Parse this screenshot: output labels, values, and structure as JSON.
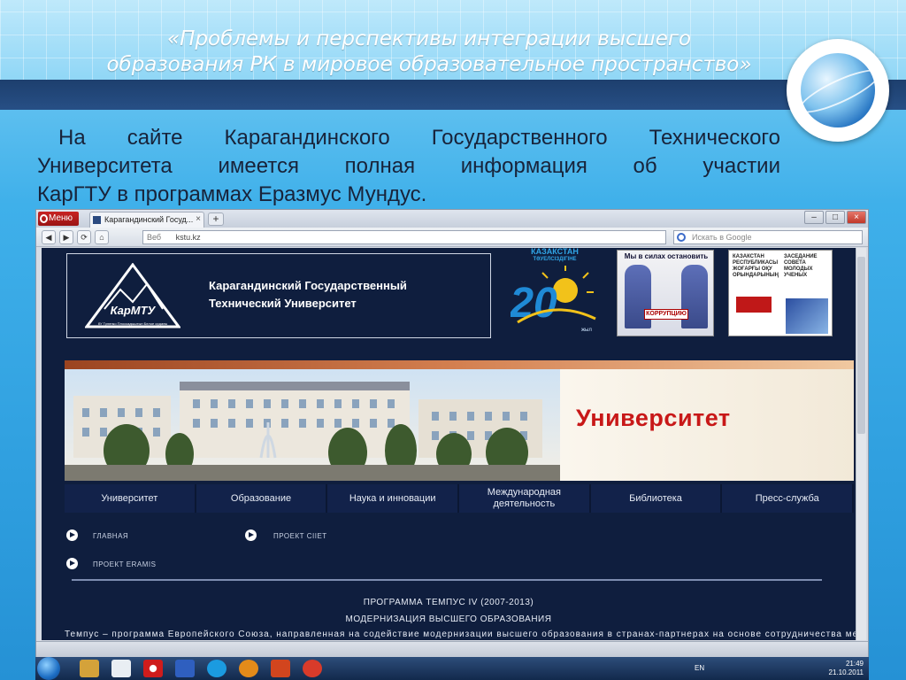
{
  "slide": {
    "title_lines": [
      "«Проблемы и перспективы интеграции высшего",
      "образования РК в мировое образовательное пространство»"
    ],
    "body_lines": [
      "На сайте Карагандинского Государственного Технического",
      "Университета имеется полная информация об участии",
      "КарГТУ в программах Еразмус Мундус."
    ]
  },
  "browser": {
    "menu_label": "Меню",
    "tab_title": "Карагандинский Госуд...",
    "new_tab": "+",
    "address_prefix": "Веб",
    "address_url": "kstu.kz",
    "search_placeholder": "Искать в Google",
    "nav_glyphs": {
      "back": "◀",
      "forward": "▶",
      "reload": "⟳",
      "home": "⌂"
    },
    "window_buttons": {
      "minimize": "–",
      "maximize": "□",
      "close": "×"
    }
  },
  "site": {
    "logo_text": "КарМТУ",
    "logo_subtext": "бУ Туленко Плоскадыштын Белое орданы",
    "university_name_lines": [
      "Карагандинский Государственный",
      "Технический Университет"
    ],
    "jubilee_lines": [
      "КАЗАКСТАН",
      "ТӘУЕЛСІЗДІГІНЕ"
    ],
    "jubilee_number": "20",
    "jubilee_suffix": "жыл",
    "poster1_title": "Мы в силах остановить",
    "poster1_badge": "КОРРУПЦИЮ",
    "poster2_col1": "КАЗАКСТАН РЕСПУБЛИКАСЫ ЖОҒАРҒЫ ОҚУ ОРЫНДАРЫНЫҢ",
    "poster2_col2": "ЗАСЕДАНИЕ СОВЕТА МОЛОДЫХ УЧЕНЫХ",
    "banner_word": "Университет",
    "menu": [
      "Университет",
      "Образование",
      "Наука и инновации",
      "Международная деятельность",
      "Библиотека",
      "Пресс-служба"
    ],
    "links": {
      "home": "ГЛАВНАЯ",
      "ciiet": "ПРОЕКТ CIIET",
      "eramis": "ПРОЕКТ ERAMIS"
    },
    "program_title": "ПРОГРАММА ТЕМПУС IV (2007-2013)",
    "program_subtitle": "МОДЕРНИЗАЦИЯ ВЫСШЕГО ОБРАЗОВАНИЯ",
    "tempus_text": "Темпус – программа Европейского Союза, направленная на содействие модернизации высшего образования в странах-партнерах на основе сотрудничества между"
  },
  "taskbar": {
    "lang": "EN",
    "time": "21:49",
    "date": "21.10.2011"
  },
  "colors": {
    "site_bg": "#0f1e3e",
    "banner_red": "#c81818",
    "slide_band": "#1d3f6e"
  }
}
